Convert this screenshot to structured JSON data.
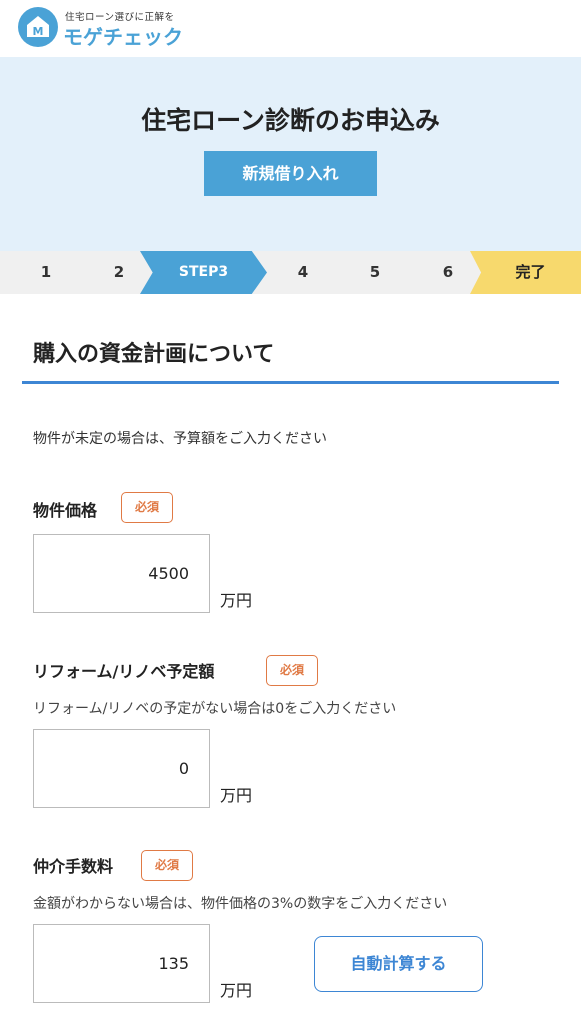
{
  "header": {
    "tagline": "住宅ローン選びに正解を",
    "site_name": "モゲチェック",
    "logo_letter": "M"
  },
  "hero": {
    "title": "住宅ローン診断のお申込み",
    "loan_type_button": "新規借り入れ"
  },
  "stepper": {
    "steps": [
      "1",
      "2",
      "STEP3",
      "4",
      "5",
      "6",
      "完了"
    ],
    "current_index": 2
  },
  "section": {
    "title": "購入の資金計画について",
    "intro": "物件が未定の場合は、予算額をご入力ください"
  },
  "fields": [
    {
      "label": "物件価格",
      "badge": "必須",
      "hint": "",
      "value": "4500",
      "unit": "万円"
    },
    {
      "label": "リフォーム/リノベ予定額",
      "badge": "必須",
      "hint": "リフォーム/リノベの予定がない場合は0をご入力ください",
      "value": "0",
      "unit": "万円"
    },
    {
      "label": "仲介手数料",
      "badge": "必須",
      "hint": "金額がわからない場合は、物件価格の3%の数字をご入力ください",
      "value": "135",
      "unit": "万円",
      "action_button": "自動計算する"
    }
  ],
  "colors": {
    "brand_blue": "#4aa2d6",
    "rule_blue": "#3d86d4",
    "hero_bg": "#e3f0fa",
    "stepper_bg": "#f0f0f0",
    "done_yellow": "#f7d96d",
    "required_orange": "#e07a45"
  },
  "icons": {
    "logo": "house-m-logo-icon"
  }
}
